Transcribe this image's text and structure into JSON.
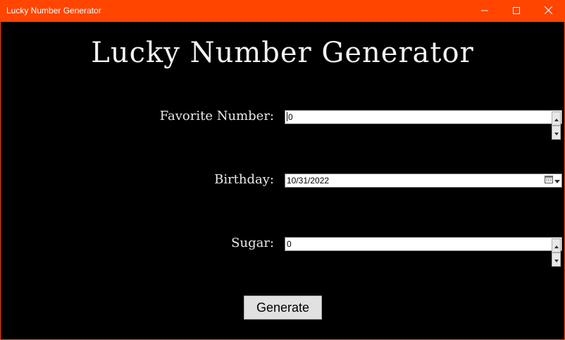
{
  "window": {
    "title": "Lucky Number Generator",
    "accent_color": "#ff4500",
    "background_color": "#000000",
    "controls": [
      "minimize-icon",
      "maximize-icon",
      "close-icon"
    ]
  },
  "header": {
    "title": "Lucky Number Generator"
  },
  "form": {
    "favorite_number": {
      "label": "Favorite Number:",
      "value": "0"
    },
    "birthday": {
      "label": "Birthday:",
      "value": "10/31/2022",
      "icon": "calendar-icon"
    },
    "sugar": {
      "label": "Sugar:",
      "value": "0"
    }
  },
  "actions": {
    "generate_label": "Generate"
  }
}
